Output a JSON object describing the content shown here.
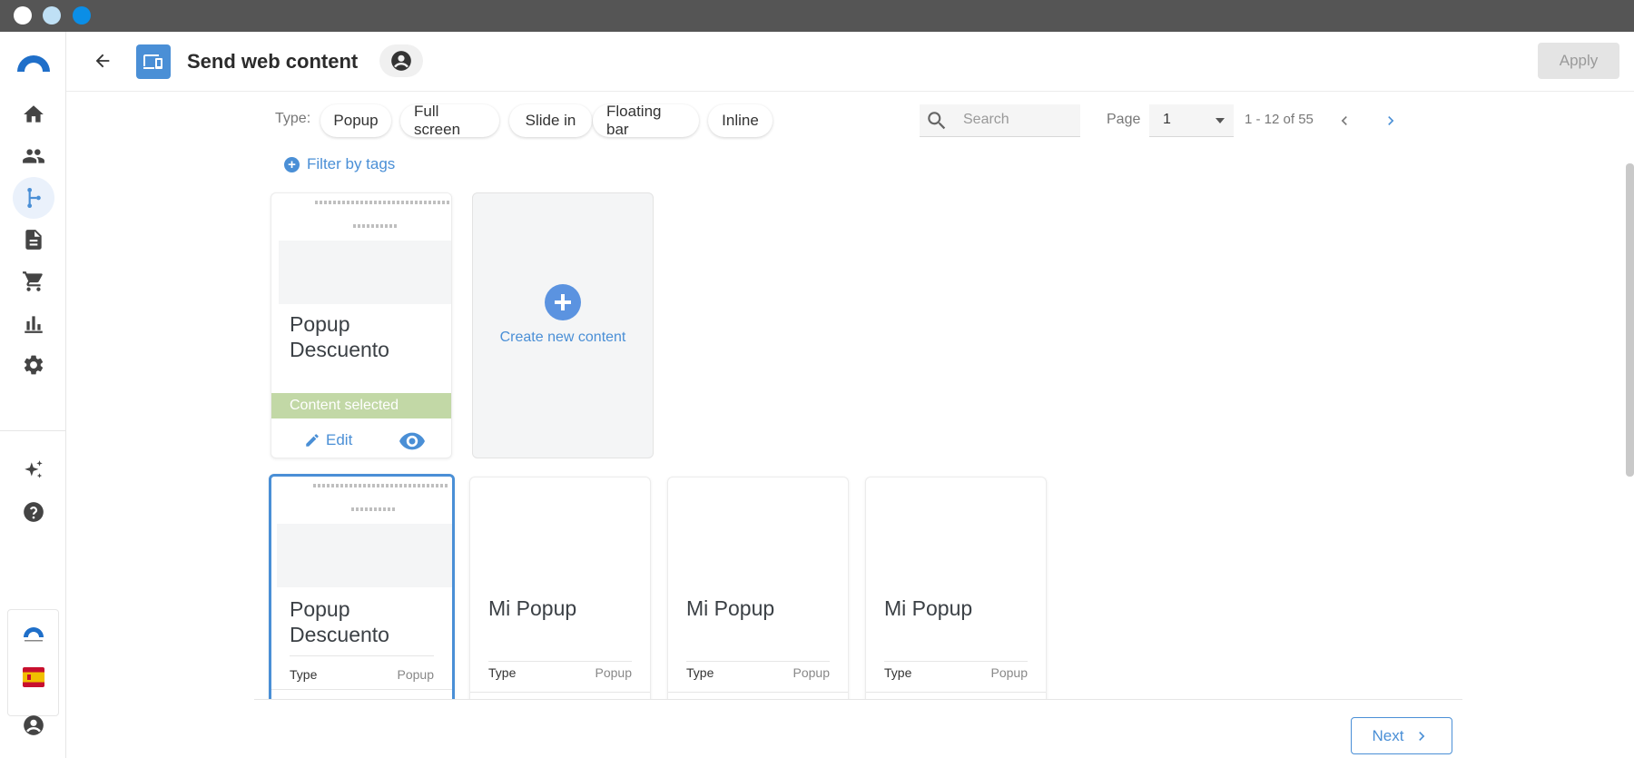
{
  "header": {
    "title": "Send web content",
    "apply_label": "Apply"
  },
  "filters": {
    "type_label": "Type:",
    "types": [
      "Popup",
      "Full screen",
      "Slide in",
      "Floating bar",
      "Inline"
    ],
    "filter_tags_label": "Filter by tags",
    "search_placeholder": "Search"
  },
  "pagination": {
    "page_label": "Page",
    "current_page": "1",
    "range_text": "1 - 12 of 55"
  },
  "selected_card": {
    "title": "Popup Descuento",
    "status": "Content selected",
    "edit_label": "Edit"
  },
  "create_card": {
    "label": "Create new content"
  },
  "cards": [
    {
      "title": "Popup Descuento",
      "type_key": "Type",
      "type_value": "Popup"
    },
    {
      "title": "Mi Popup",
      "type_key": "Type",
      "type_value": "Popup"
    },
    {
      "title": "Mi Popup",
      "type_key": "Type",
      "type_value": "Popup"
    },
    {
      "title": "Mi Popup",
      "type_key": "Type",
      "type_value": "Popup"
    }
  ],
  "footer": {
    "next_label": "Next"
  },
  "sidebar": {
    "items": [
      "home-icon",
      "people-icon",
      "flow-icon",
      "document-icon",
      "cart-icon",
      "chart-icon",
      "gear-icon",
      "sparkle-icon",
      "help-icon"
    ]
  },
  "colors": {
    "accent": "#4a8fd6",
    "selected_banner": "#c2d8a6",
    "title_bar": "#555555"
  }
}
